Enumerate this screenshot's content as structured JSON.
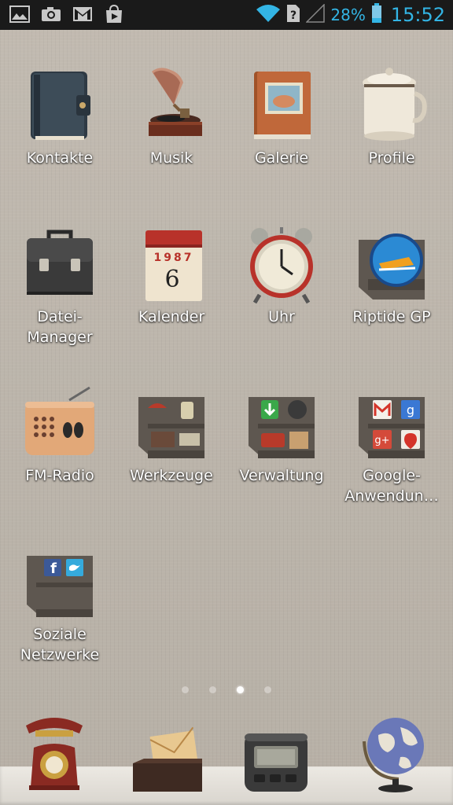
{
  "status_bar": {
    "left_icons": [
      "gallery-icon",
      "camera-icon",
      "gmail-icon",
      "play-store-icon"
    ],
    "battery_percent": "28%",
    "time": "15:52",
    "accent_color": "#33b5e5"
  },
  "apps": [
    {
      "label": "Kontakte",
      "icon": "address-book-icon"
    },
    {
      "label": "Musik",
      "icon": "gramophone-icon"
    },
    {
      "label": "Galerie",
      "icon": "picture-book-icon"
    },
    {
      "label": "Profile",
      "icon": "enamel-pot-icon"
    },
    {
      "label": "Datei-\nManager",
      "line1": "Datei-",
      "line2": "Manager",
      "icon": "briefcase-icon"
    },
    {
      "label": "Kalender",
      "icon": "calendar-icon",
      "calendar_year": "1987",
      "calendar_day": "6"
    },
    {
      "label": "Uhr",
      "icon": "alarm-clock-icon"
    },
    {
      "label": "Riptide GP",
      "icon": "riptide-gp-icon"
    },
    {
      "label": "FM-Radio",
      "icon": "radio-icon"
    },
    {
      "label": "Werkzeuge",
      "icon": "tools-folder-icon"
    },
    {
      "label": "Verwaltung",
      "icon": "management-folder-icon"
    },
    {
      "label": "Google-\nAnwendun…",
      "line1": "Google-",
      "line2": "Anwendun…",
      "icon": "google-folder-icon"
    },
    {
      "label": "Soziale\nNetzwerke",
      "line1": "Soziale",
      "line2": "Netzwerke",
      "icon": "social-folder-icon"
    }
  ],
  "page_indicator": {
    "count": 4,
    "active": 3
  },
  "dock": [
    {
      "name": "phone",
      "icon": "telephone-icon"
    },
    {
      "name": "messages",
      "icon": "envelope-icon"
    },
    {
      "name": "pager",
      "icon": "pager-icon"
    },
    {
      "name": "browser",
      "icon": "globe-icon"
    }
  ]
}
